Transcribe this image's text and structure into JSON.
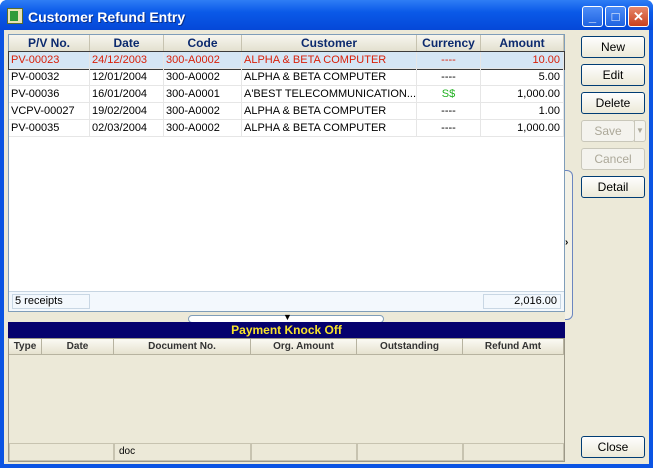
{
  "window": {
    "title": "Customer Refund Entry"
  },
  "grid": {
    "columns": [
      "P/V No.",
      "Date",
      "Code",
      "Customer",
      "Currency",
      "Amount"
    ],
    "rows": [
      {
        "pv": "PV-00023",
        "date": "24/12/2003",
        "code": "300-A0002",
        "customer": "ALPHA & BETA COMPUTER",
        "currency": "----",
        "amount": "10.00",
        "selected": true
      },
      {
        "pv": "PV-00032",
        "date": "12/01/2004",
        "code": "300-A0002",
        "customer": "ALPHA & BETA COMPUTER",
        "currency": "----",
        "amount": "5.00"
      },
      {
        "pv": "PV-00036",
        "date": "16/01/2004",
        "code": "300-A0001",
        "customer": "A'BEST TELECOMMUNICATION...",
        "currency": "S$",
        "amount": "1,000.00"
      },
      {
        "pv": "VCPV-00027",
        "date": "19/02/2004",
        "code": "300-A0002",
        "customer": "ALPHA & BETA COMPUTER",
        "currency": "----",
        "amount": "1.00"
      },
      {
        "pv": "PV-00035",
        "date": "02/03/2004",
        "code": "300-A0002",
        "customer": "ALPHA & BETA COMPUTER",
        "currency": "----",
        "amount": "1,000.00"
      }
    ],
    "footer_count": "5 receipts",
    "footer_total": "2,016.00"
  },
  "knockoff": {
    "title": "Payment Knock Off",
    "columns": [
      "Type",
      "Date",
      "Document No.",
      "Org. Amount",
      "Outstanding",
      "Refund Amt"
    ],
    "footer_doc": "doc"
  },
  "buttons": {
    "new": "New",
    "edit": "Edit",
    "delete": "Delete",
    "save": "Save",
    "cancel": "Cancel",
    "detail": "Detail",
    "close": "Close"
  },
  "colors": {
    "selected_text": "#d8200a",
    "currency_green": "#20b020",
    "knockoff_bar": "#05016e",
    "knockoff_text": "#f7e22b"
  }
}
